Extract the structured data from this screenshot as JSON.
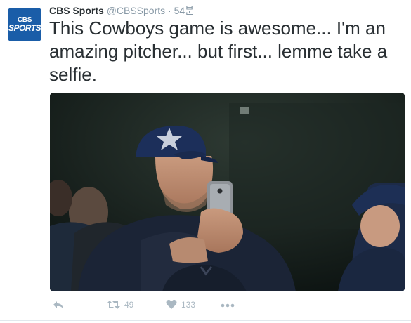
{
  "tweet": {
    "avatar_text": [
      "CBS",
      "SPORTS"
    ],
    "display_name": "CBS Sports",
    "handle": "@CBSSports",
    "separator": "·",
    "time": "54분",
    "text": "This Cowboys game is awesome... I'm an amazing pitcher... but first... lemme take a selfie.",
    "actions": {
      "reply_icon": "reply-icon",
      "retweet_icon": "retweet-icon",
      "retweet_count": "49",
      "like_icon": "heart-icon",
      "like_count": "133",
      "more_icon": "more-icon"
    }
  },
  "colors": {
    "text": "#292f33",
    "muted": "#8899a6",
    "action_gray": "#aab8c2",
    "avatar_bg": "#1a5da8",
    "divider": "#e1e8ed"
  }
}
